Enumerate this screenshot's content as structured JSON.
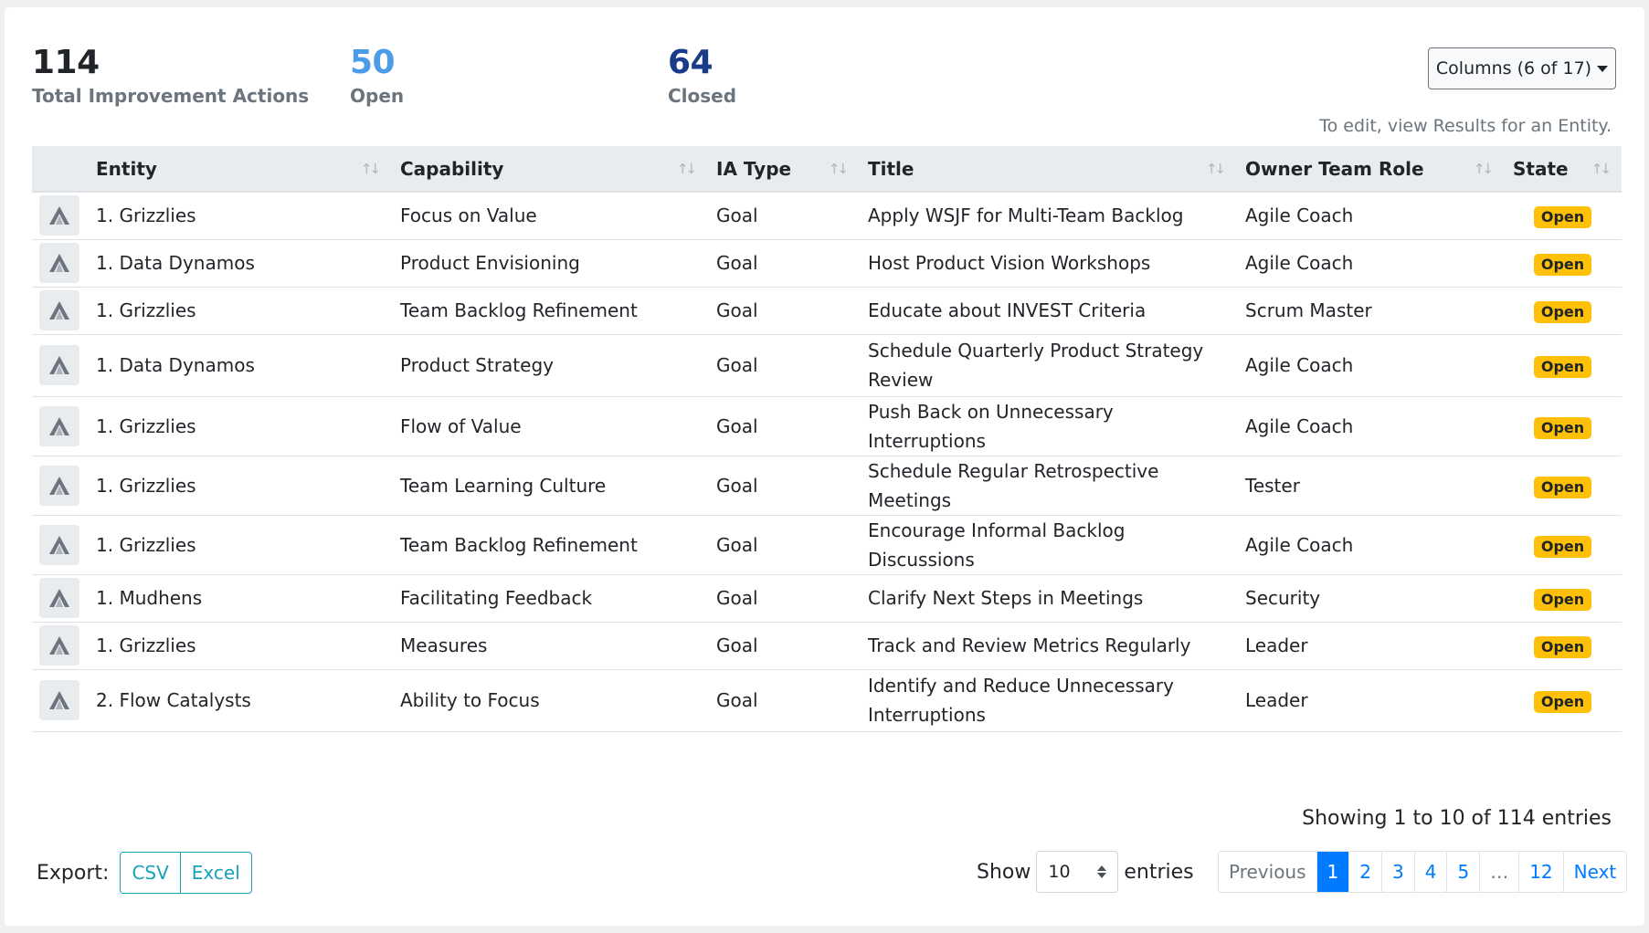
{
  "stats": [
    {
      "value": "114",
      "label": "Total Improvement Actions",
      "color": "#212529"
    },
    {
      "value": "50",
      "label": "Open",
      "color": "#4a9ce8"
    },
    {
      "value": "64",
      "label": "Closed",
      "color": "#1a3a8a"
    }
  ],
  "columns_button": "Columns (6 of 17)",
  "edit_note": "To edit, view Results for an Entity.",
  "table": {
    "headers": [
      "Entity",
      "Capability",
      "IA Type",
      "Title",
      "Owner Team Role",
      "State"
    ],
    "rows": [
      {
        "entity": "1. Grizzlies",
        "capability": "Focus on Value",
        "ia_type": "Goal",
        "title": "Apply WSJF for Multi-Team Backlog",
        "owner": "Agile Coach",
        "state": "Open"
      },
      {
        "entity": "1. Data Dynamos",
        "capability": "Product Envisioning",
        "ia_type": "Goal",
        "title": "Host Product Vision Workshops",
        "owner": "Agile Coach",
        "state": "Open"
      },
      {
        "entity": "1. Grizzlies",
        "capability": "Team Backlog Refinement",
        "ia_type": "Goal",
        "title": "Educate about INVEST Criteria",
        "owner": "Scrum Master",
        "state": "Open"
      },
      {
        "entity": "1. Data Dynamos",
        "capability": "Product Strategy",
        "ia_type": "Goal",
        "title": "Schedule Quarterly Product Strategy Review",
        "owner": "Agile Coach",
        "state": "Open"
      },
      {
        "entity": "1. Grizzlies",
        "capability": "Flow of Value",
        "ia_type": "Goal",
        "title": "Push Back on Unnecessary Interruptions",
        "owner": "Agile Coach",
        "state": "Open"
      },
      {
        "entity": "1. Grizzlies",
        "capability": "Team Learning Culture",
        "ia_type": "Goal",
        "title": "Schedule Regular Retrospective Meetings",
        "owner": "Tester",
        "state": "Open"
      },
      {
        "entity": "1. Grizzlies",
        "capability": "Team Backlog Refinement",
        "ia_type": "Goal",
        "title": "Encourage Informal Backlog Discussions",
        "owner": "Agile Coach",
        "state": "Open"
      },
      {
        "entity": "1. Mudhens",
        "capability": "Facilitating Feedback",
        "ia_type": "Goal",
        "title": "Clarify Next Steps in Meetings",
        "owner": "Security",
        "state": "Open"
      },
      {
        "entity": "1. Grizzlies",
        "capability": "Measures",
        "ia_type": "Goal",
        "title": "Track and Review Metrics Regularly",
        "owner": "Leader",
        "state": "Open"
      },
      {
        "entity": "2. Flow Catalysts",
        "capability": "Ability to Focus",
        "ia_type": "Goal",
        "title": "Identify and Reduce Unnecessary Interruptions",
        "owner": "Leader",
        "state": "Open"
      }
    ]
  },
  "footer": {
    "showing": "Showing 1 to 10 of 114 entries",
    "export_label": "Export:",
    "export_buttons": [
      "CSV",
      "Excel"
    ],
    "show_label": "Show",
    "page_size": "10",
    "entries_label": "entries",
    "pagination": [
      "Previous",
      "1",
      "2",
      "3",
      "4",
      "5",
      "…",
      "12",
      "Next"
    ],
    "active_page": "1"
  },
  "colors": {
    "open_badge": "#ffc107",
    "accent": "#007bff",
    "export": "#17a2b8"
  }
}
